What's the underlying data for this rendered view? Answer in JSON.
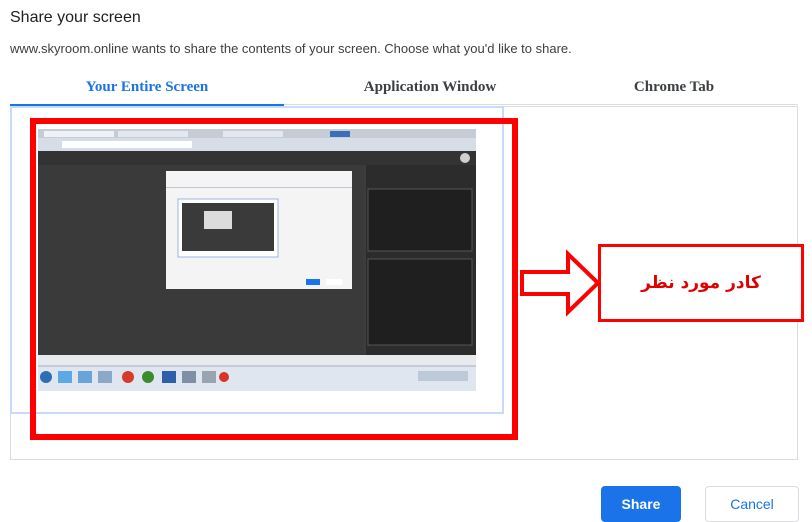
{
  "dialog": {
    "title": "Share your screen",
    "description": "www.skyroom.online wants to share the contents of your screen. Choose what you'd like to share."
  },
  "tabs": [
    {
      "label": "Your Entire Screen",
      "active": true
    },
    {
      "label": "Application Window",
      "active": false
    },
    {
      "label": "Chrome Tab",
      "active": false
    }
  ],
  "annotation": {
    "callout_text": "کادر مورد نظر",
    "color": "#ff0000"
  },
  "buttons": {
    "share_label": "Share",
    "cancel_label": "Cancel"
  },
  "colors": {
    "accent": "#1a73e8",
    "border": "#dadce0"
  }
}
